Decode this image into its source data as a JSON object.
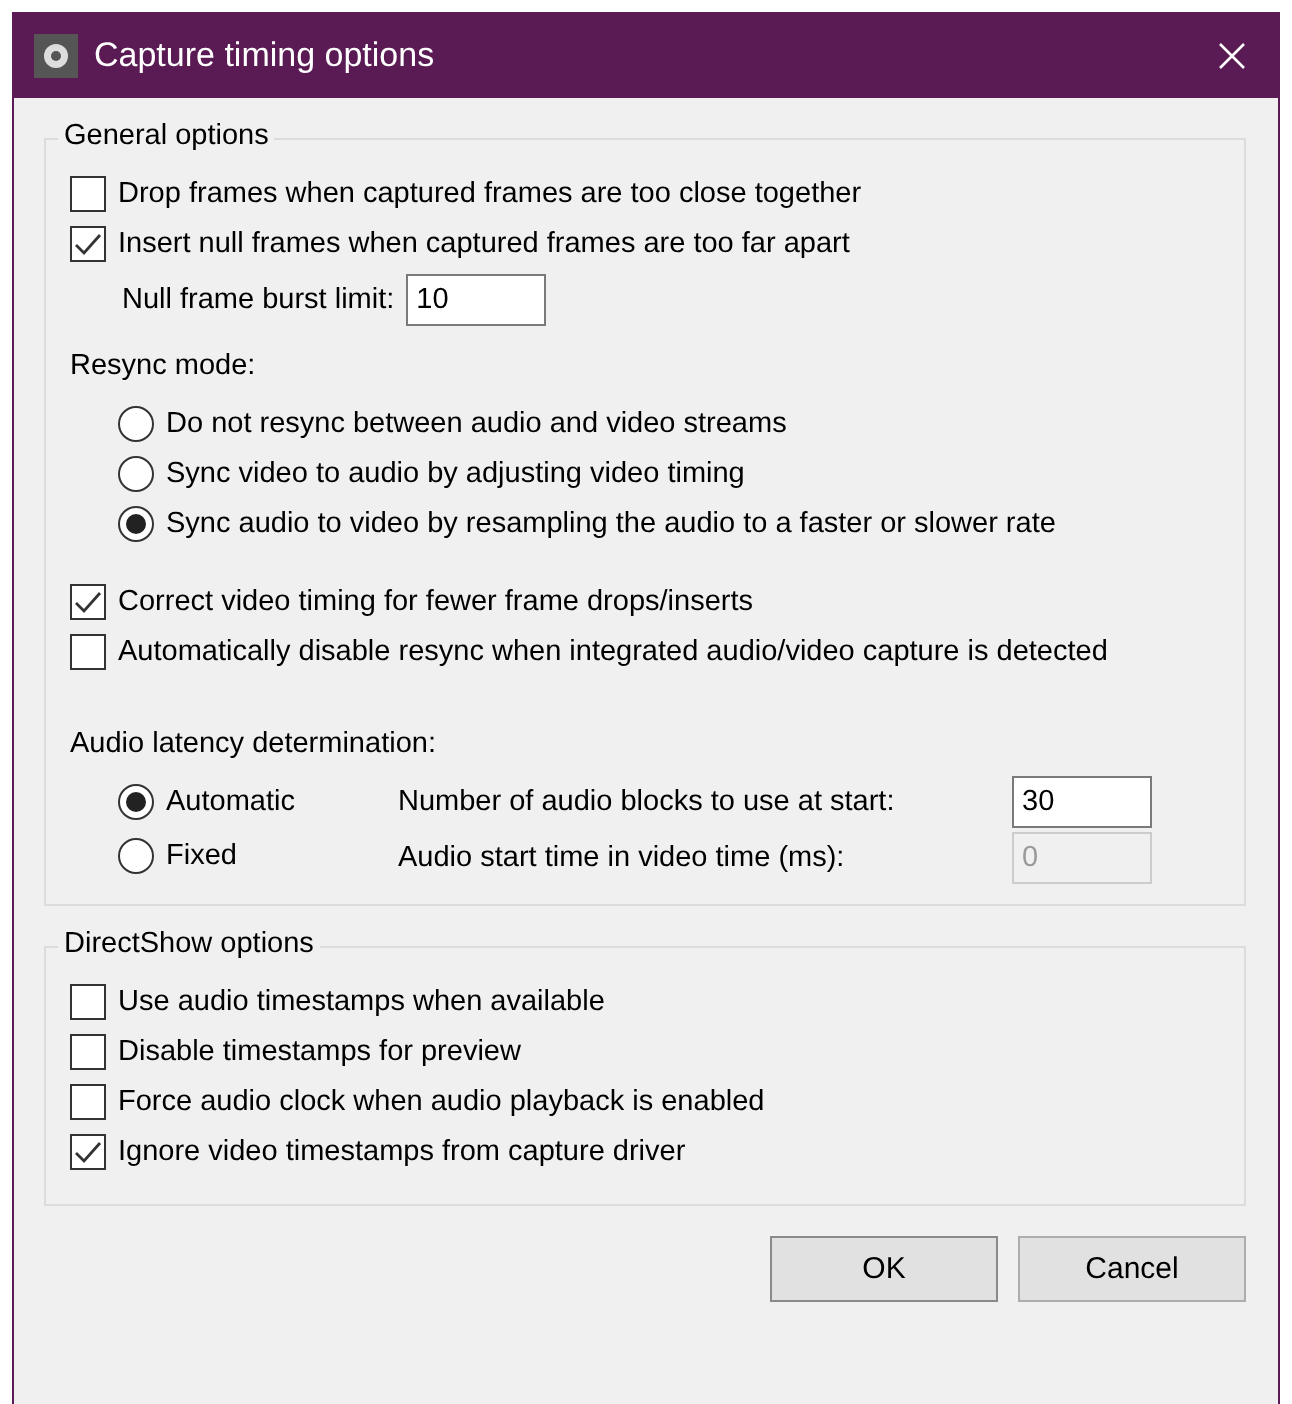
{
  "window": {
    "title": "Capture timing options"
  },
  "general": {
    "title": "General options",
    "checkboxes": [
      {
        "label": "Drop frames when captured frames are too close together",
        "checked": false
      },
      {
        "label": "Insert null frames when captured frames are too far apart",
        "checked": true
      }
    ],
    "burst": {
      "label": "Null frame burst limit:",
      "value": "10"
    },
    "resync": {
      "label": "Resync mode:",
      "options": [
        {
          "label": "Do not resync between audio and video streams",
          "selected": false
        },
        {
          "label": "Sync video to audio by adjusting video timing",
          "selected": false
        },
        {
          "label": "Sync audio to video by resampling the audio to a faster or slower rate",
          "selected": true
        }
      ]
    },
    "more_checkboxes": [
      {
        "label": "Correct video timing for fewer frame drops/inserts",
        "checked": true
      },
      {
        "label": "Automatically disable resync when integrated audio/video capture is detected",
        "checked": false
      }
    ],
    "latency": {
      "label": "Audio latency determination:",
      "modes": [
        {
          "label": "Automatic",
          "selected": true
        },
        {
          "label": "Fixed",
          "selected": false
        }
      ],
      "fields": [
        {
          "label": "Number of audio blocks to use at start:",
          "value": "30",
          "disabled": false
        },
        {
          "label": "Audio start time in video time (ms):",
          "value": "0",
          "disabled": true
        }
      ]
    }
  },
  "directshow": {
    "title": "DirectShow options",
    "checkboxes": [
      {
        "label": "Use audio timestamps when available",
        "checked": false
      },
      {
        "label": "Disable timestamps for preview",
        "checked": false
      },
      {
        "label": "Force audio clock when audio playback is enabled",
        "checked": false
      },
      {
        "label": "Ignore video timestamps from capture driver",
        "checked": true
      }
    ]
  },
  "buttons": [
    {
      "label": "OK"
    },
    {
      "label": "Cancel"
    }
  ]
}
